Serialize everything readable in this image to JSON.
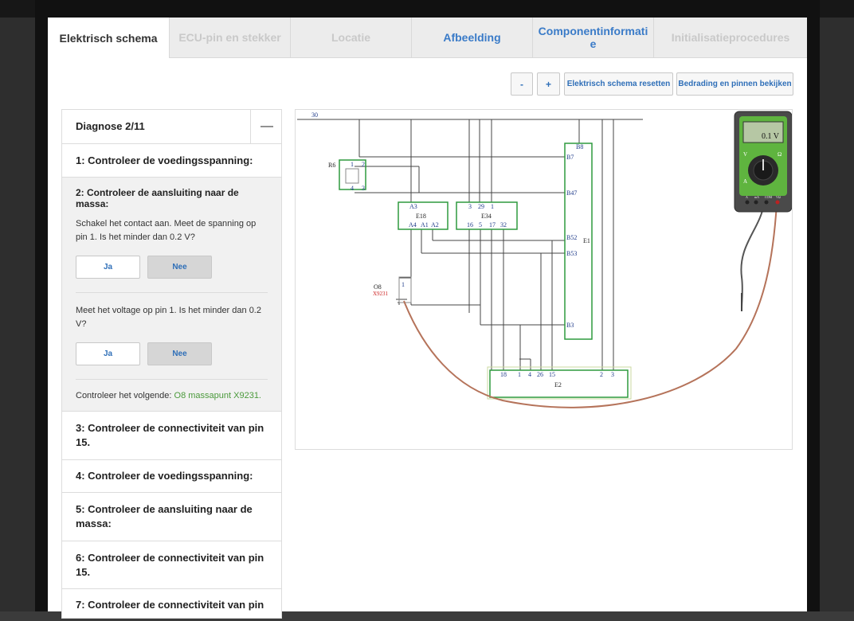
{
  "tabs": [
    {
      "label": "Elektrisch schema",
      "state": "active"
    },
    {
      "label": "ECU-pin en stekker",
      "state": "disabled"
    },
    {
      "label": "Locatie",
      "state": "disabled"
    },
    {
      "label": "Afbeelding",
      "state": "enabled"
    },
    {
      "label": "Componentinformati e",
      "state": "enabled"
    },
    {
      "label": "Initialisatieprocedures",
      "state": "disabled"
    }
  ],
  "toolbar": {
    "zoom_out": "-",
    "zoom_in": "+",
    "reset": "Elektrisch schema resetten",
    "wiring": "Bedrading en pinnen bekijken"
  },
  "diagnosis": {
    "title": "Diagnose 2/11",
    "collapse_symbol": "—",
    "step1": "1: Controleer de voedingsspanning:",
    "current": {
      "title": "2: Controleer de aansluiting naar de massa:",
      "q1": "Schakel het contact aan. Meet de spanning op pin 1. Is het minder dan 0.2 V?",
      "q2": "Meet het voltage op pin 1. Is het minder dan 0.2 V?",
      "yes": "Ja",
      "no": "Nee",
      "check_prefix": "Controleer het volgende:",
      "check_target": "O8 massapunt X9231."
    },
    "steps": [
      "3: Controleer de connectiviteit van pin 15.",
      "4: Controleer de voedingsspanning:",
      "5: Controleer de aansluiting naar de massa:",
      "6: Controleer de connectiviteit van pin 15.",
      "7: Controleer de connectiviteit van pin"
    ]
  },
  "schematic": {
    "rail": "30",
    "r6": {
      "name": "R6",
      "pins": [
        "1",
        "2",
        "4",
        "3"
      ]
    },
    "e18": {
      "name": "E18",
      "top": "A3",
      "pins": [
        "A4",
        "A1",
        "A2"
      ]
    },
    "e34": {
      "name": "E34",
      "top_pins": [
        "3",
        "29",
        "1"
      ],
      "pins": [
        "16",
        "5",
        "17",
        "32"
      ]
    },
    "e1": {
      "name": "E1",
      "pins": [
        "B8",
        "B7",
        "B47",
        "B52",
        "B53",
        "B3"
      ]
    },
    "e2": {
      "name": "E2",
      "pins": [
        "18",
        "1",
        "4",
        "26",
        "15",
        "2",
        "3"
      ]
    },
    "o8": {
      "name": "O8",
      "sub": "X9231",
      "pin": "1"
    }
  },
  "multimeter": {
    "reading": "0.1 V",
    "dial_labels": [
      "V",
      "Ω",
      "A"
    ],
    "jacks": [
      "A",
      "mA",
      "COM",
      "VΩ"
    ]
  },
  "colors": {
    "accent": "#3a7bc8",
    "component_green": "#2e9a3e",
    "probe_wire": "#b5735a",
    "check_green": "#4b9a3c"
  }
}
